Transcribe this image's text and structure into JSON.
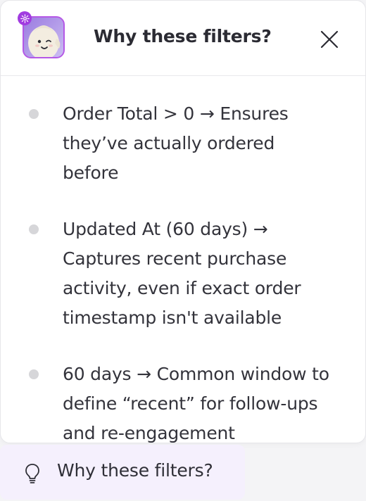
{
  "panel": {
    "title": "Why these filters?",
    "items": [
      {
        "text": "Order Total > 0 → Ensures they’ve actually ordered before"
      },
      {
        "text": "Updated At (60 days) → Captures recent purchase activity, even if exact order timestamp isn't available"
      },
      {
        "text": "60 days → Common window to define “recent” for follow-ups and re-engagement"
      }
    ]
  },
  "chip": {
    "label": "Why these filters?"
  },
  "icons": {
    "avatar": "assistant-avatar",
    "badge": "sparkle-icon",
    "close": "close-icon",
    "lightbulb": "lightbulb-icon"
  },
  "colors": {
    "accent": "#b558e6",
    "chip_bg": "#f5f0fd",
    "bullet": "#d6d6d9"
  }
}
